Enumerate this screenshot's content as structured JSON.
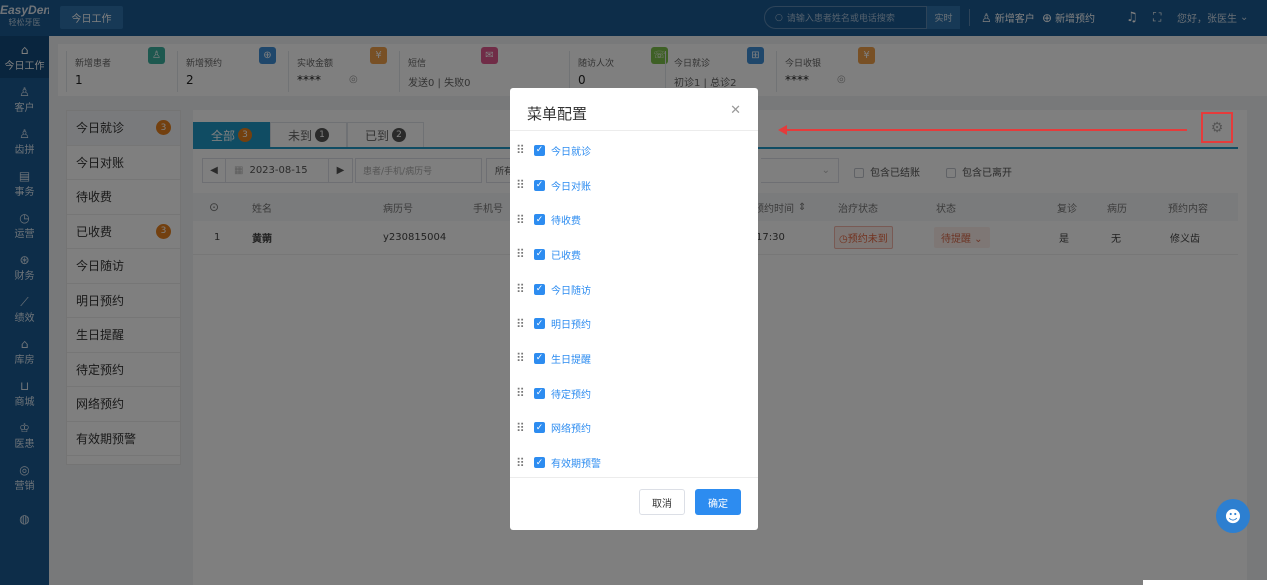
{
  "brand": {
    "name": "EasyDent",
    "sub": "轻松牙医"
  },
  "sidebar": {
    "items": [
      {
        "icon": "home-icon",
        "glyph": "⌂",
        "label": "今日工作"
      },
      {
        "icon": "user-icon",
        "glyph": "♙",
        "label": "客户"
      },
      {
        "icon": "tooth-icon",
        "glyph": "♙",
        "label": "齿拼"
      },
      {
        "icon": "clipboard-icon",
        "glyph": "▤",
        "label": "事务"
      },
      {
        "icon": "clock-icon",
        "glyph": "◷",
        "label": "运营"
      },
      {
        "icon": "wallet-icon",
        "glyph": "⊛",
        "label": "财务"
      },
      {
        "icon": "chart-icon",
        "glyph": "⟋",
        "label": "绩效"
      },
      {
        "icon": "warehouse-icon",
        "glyph": "⌂",
        "label": "库房"
      },
      {
        "icon": "cart-icon",
        "glyph": "⊔",
        "label": "商城"
      },
      {
        "icon": "doctor-icon",
        "glyph": "♔",
        "label": "医患"
      },
      {
        "icon": "marketing-icon",
        "glyph": "◎",
        "label": "营销"
      },
      {
        "icon": "more-icon",
        "glyph": "◍",
        "label": ""
      }
    ]
  },
  "topbar": {
    "tab": "今日工作",
    "search_placeholder": "请输入患者姓名或电话搜索",
    "search_button": "实时",
    "new_customer": "新增客户",
    "new_appointment": "新增预约",
    "greeting": "您好，张医生"
  },
  "stats": [
    {
      "title": "新增患者",
      "value": "1",
      "color": "#3ab09e",
      "icon": "user-add-icon",
      "glyph": "♙"
    },
    {
      "title": "新增预约",
      "value": "2",
      "color": "#3f8fd6",
      "icon": "calendar-add-icon",
      "glyph": "⊕"
    },
    {
      "title": "实收金额",
      "value": "****",
      "color": "#f0a04b",
      "icon": "money-icon",
      "glyph": "¥"
    },
    {
      "title": "短信",
      "value": "发送0 | 失败0",
      "color": "#e0598f",
      "icon": "mail-icon",
      "glyph": "✉"
    },
    {
      "title": "随访人次",
      "value": "0",
      "color": "#7cc04a",
      "icon": "phone-icon",
      "glyph": "☏"
    },
    {
      "title": "今日就诊",
      "value": "初诊1 | 总诊2",
      "color": "#3f8fd6",
      "icon": "visit-icon",
      "glyph": "⊞"
    },
    {
      "title": "今日收银",
      "value": "****",
      "color": "#f0a04b",
      "icon": "cashier-icon",
      "glyph": "¥"
    }
  ],
  "leftmenu": [
    {
      "label": "今日就诊",
      "badge": "3"
    },
    {
      "label": "今日对账",
      "badge": ""
    },
    {
      "label": "待收费",
      "badge": ""
    },
    {
      "label": "已收费",
      "badge": "3"
    },
    {
      "label": "今日随访",
      "badge": ""
    },
    {
      "label": "明日预约",
      "badge": ""
    },
    {
      "label": "生日提醒",
      "badge": ""
    },
    {
      "label": "待定预约",
      "badge": ""
    },
    {
      "label": "网络预约",
      "badge": ""
    },
    {
      "label": "有效期预警",
      "badge": ""
    }
  ],
  "tabs": [
    {
      "label": "全部",
      "count": "3"
    },
    {
      "label": "未到",
      "count": "1"
    },
    {
      "label": "已到",
      "count": "2"
    }
  ],
  "filter": {
    "date": "2023-08-15",
    "search_placeholder": "患者/手机/病历号",
    "select_all": "所有",
    "include_settled": "包含已结账",
    "include_left": "包含已离开"
  },
  "table": {
    "headers": [
      "姓名",
      "病历号",
      "手机号",
      "预约时间",
      "治疗状态",
      "状态",
      "复诊",
      "病历",
      "预约内容"
    ],
    "rows": [
      {
        "index": "1",
        "name": "黄蒴",
        "record": "y230815004",
        "time": "17:30",
        "treat": "预约未到",
        "status": "待提醒",
        "revisit": "是",
        "emr": "无",
        "content": "修义齿"
      }
    ]
  },
  "modal": {
    "title": "菜单配置",
    "items": [
      "今日就诊",
      "今日对账",
      "待收费",
      "已收费",
      "今日随访",
      "明日预约",
      "生日提醒",
      "待定预约",
      "网络预约",
      "有效期预警"
    ],
    "cancel": "取消",
    "ok": "确定"
  }
}
